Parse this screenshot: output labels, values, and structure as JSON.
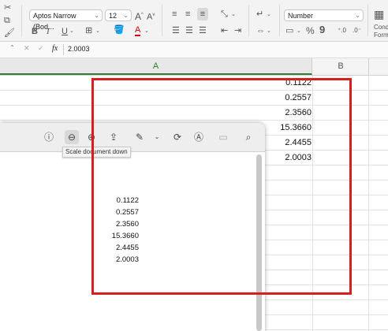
{
  "ribbon": {
    "font_name": "Aptos Narrow (Bod...",
    "font_size": "12",
    "number_format": "Number",
    "bold": "B",
    "italic": "I",
    "underline": "U",
    "increase_font": "A",
    "decrease_font": "A",
    "percent": "%",
    "comma": "9",
    "cond_label_1": "Cond",
    "cond_label_2": "Form"
  },
  "formula_bar": {
    "name_box_arrow": "⌃",
    "cancel": "✕",
    "confirm": "✓",
    "fx": "fx",
    "value": "2.0003"
  },
  "columns": [
    "A",
    "B"
  ],
  "cells": [
    "0.1122",
    "0.2557",
    "2.3560",
    "15.3660",
    "2.4455",
    "2.0003"
  ],
  "preview": {
    "tooltip": "Scale document down",
    "values": [
      "0.1122",
      "0.2557",
      "2.3560",
      "15.3660",
      "2.4455",
      "2.0003"
    ]
  },
  "highlight_color": "#d81f1f"
}
